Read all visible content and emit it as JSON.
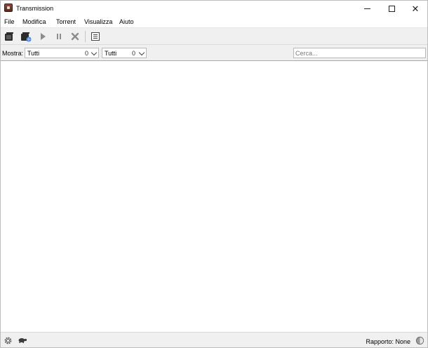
{
  "window": {
    "title": "Transmission"
  },
  "menu": {
    "items": [
      {
        "label": "File"
      },
      {
        "label": "Modifica"
      },
      {
        "label": "Torrent"
      },
      {
        "label": "Visualizza"
      },
      {
        "label": "Aiuto"
      }
    ]
  },
  "toolbar": {
    "icons": [
      "open-torrent-icon",
      "open-url-icon",
      "start-icon",
      "pause-icon",
      "remove-icon",
      "properties-icon"
    ]
  },
  "filter": {
    "label": "Mostra:",
    "activity": {
      "value": "Tutti",
      "count": "0"
    },
    "tracker": {
      "value": "Tutti",
      "count": "0"
    },
    "search_placeholder": "Cerca..."
  },
  "status": {
    "ratio_label": "Rapporto: None"
  },
  "colors": {
    "toolbar_bg": "#f0f0f0",
    "list_bg": "#ffffff",
    "border": "#a9a9a9"
  }
}
